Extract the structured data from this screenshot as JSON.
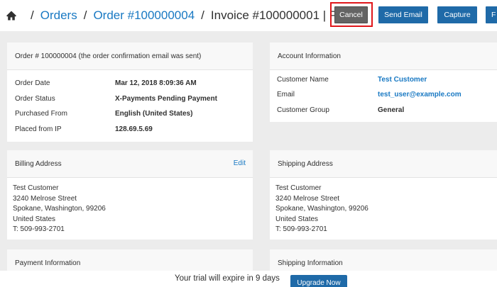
{
  "breadcrumb": {
    "orders": "Orders",
    "order": "Order #100000004",
    "invoice": "Invoice #100000001 | Pend...",
    "separator": "/"
  },
  "toolbar": {
    "cancel": "Cancel",
    "send_email": "Send Email",
    "capture": "Capture",
    "more": "F"
  },
  "order_panel": {
    "title": "Order # 100000004 (the order confirmation email was sent)",
    "rows": [
      {
        "label": "Order Date",
        "value": "Mar 12, 2018 8:09:36 AM"
      },
      {
        "label": "Order Status",
        "value": "X-Payments Pending Payment"
      },
      {
        "label": "Purchased From",
        "value": "English (United States)"
      },
      {
        "label": "Placed from IP",
        "value": "128.69.5.69"
      }
    ]
  },
  "account_panel": {
    "title": "Account Information",
    "rows": [
      {
        "label": "Customer Name",
        "value": "Test Customer"
      },
      {
        "label": "Email",
        "value": "test_user@example.com"
      },
      {
        "label": "Customer Group",
        "value": "General"
      }
    ]
  },
  "billing_panel": {
    "title": "Billing Address",
    "edit": "Edit",
    "lines": [
      "Test Customer",
      "3240 Melrose Street",
      "Spokane, Washington, 99206",
      "United States",
      "T: 509-993-2701"
    ]
  },
  "shipping_panel": {
    "title": "Shipping Address",
    "lines": [
      "Test Customer",
      "3240 Melrose Street",
      "Spokane, Washington, 99206",
      "United States",
      "T: 509-993-2701"
    ]
  },
  "payment_panel": {
    "title": "Payment Information"
  },
  "shipping_info_panel": {
    "title": "Shipping Information"
  },
  "trial_bar": {
    "message": "Your trial will expire in 9 days",
    "upgrade": "Upgrade Now"
  },
  "colors": {
    "link": "#1979c3",
    "button": "#1f6aa8",
    "cancel": "#646464",
    "highlight": "#e0161a"
  }
}
